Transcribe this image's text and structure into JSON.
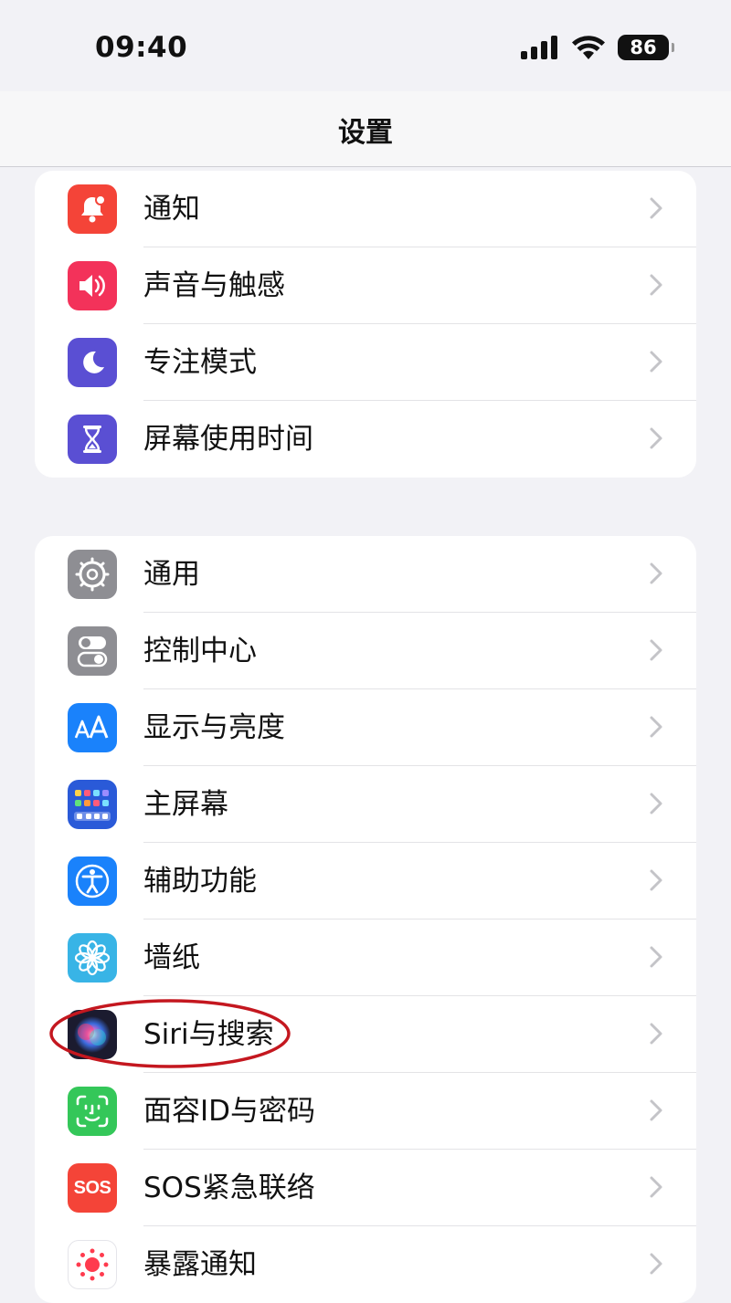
{
  "status_bar": {
    "time": "09:40",
    "battery": "86"
  },
  "nav": {
    "title": "设置"
  },
  "group1": [
    {
      "label": "通知",
      "icon": "notifications-icon",
      "color": "#f44438"
    },
    {
      "label": "声音与触感",
      "icon": "sound-icon",
      "color": "#f3325a"
    },
    {
      "label": "专注模式",
      "icon": "moon-icon",
      "color": "#5a4fd3"
    },
    {
      "label": "屏幕使用时间",
      "icon": "hourglass-icon",
      "color": "#5a4fd3"
    }
  ],
  "group2": [
    {
      "label": "通用",
      "icon": "gear-icon",
      "color": "#8e8e93"
    },
    {
      "label": "控制中心",
      "icon": "toggles-icon",
      "color": "#8e8e93"
    },
    {
      "label": "显示与亮度",
      "icon": "text-size-icon",
      "color": "#1a82fb"
    },
    {
      "label": "主屏幕",
      "icon": "home-screen-icon",
      "color": "#2a5ad8"
    },
    {
      "label": "辅助功能",
      "icon": "accessibility-icon",
      "color": "#1a82fb"
    },
    {
      "label": "墙纸",
      "icon": "wallpaper-flower-icon",
      "color": "#38b4e6"
    },
    {
      "label": "Siri与搜索",
      "icon": "siri-icon",
      "color": "#1b1b2f"
    },
    {
      "label": "面容ID与密码",
      "icon": "face-id-icon",
      "color": "#34c759"
    },
    {
      "label": "SOS紧急联络",
      "icon": "sos-icon",
      "color": "#f44438",
      "icon_text": "SOS"
    },
    {
      "label": "暴露通知",
      "icon": "exposure-icon",
      "color": "#ffffff"
    }
  ],
  "annotation": {
    "highlight_color": "#c4171f"
  }
}
